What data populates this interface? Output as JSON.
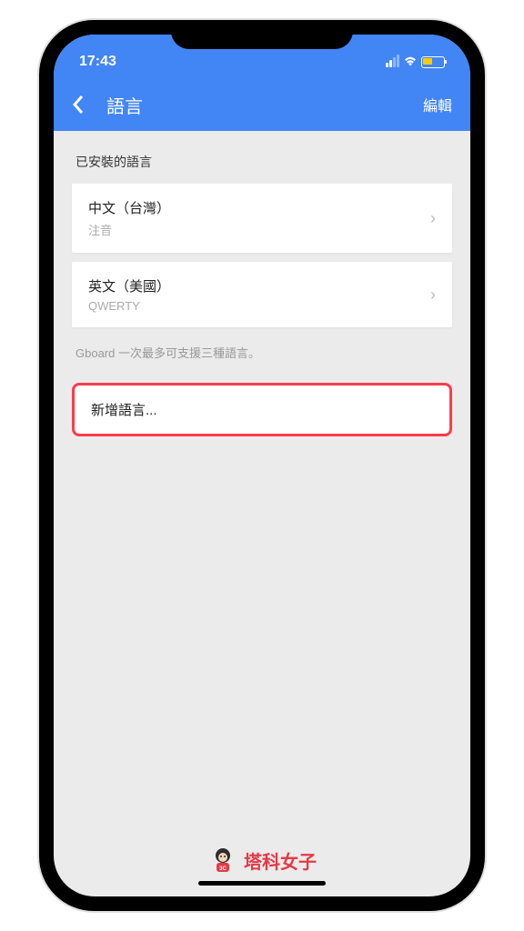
{
  "status": {
    "time": "17:43"
  },
  "nav": {
    "title": "語言",
    "edit_label": "編輯"
  },
  "section": {
    "header": "已安裝的語言"
  },
  "languages": [
    {
      "name": "中文（台灣）",
      "layout": "注音"
    },
    {
      "name": "英文（美國）",
      "layout": "QWERTY"
    }
  ],
  "hint": "Gboard 一次最多可支援三種語言。",
  "add_language": {
    "label": "新增語言..."
  },
  "watermark": {
    "text": "塔科女子"
  }
}
